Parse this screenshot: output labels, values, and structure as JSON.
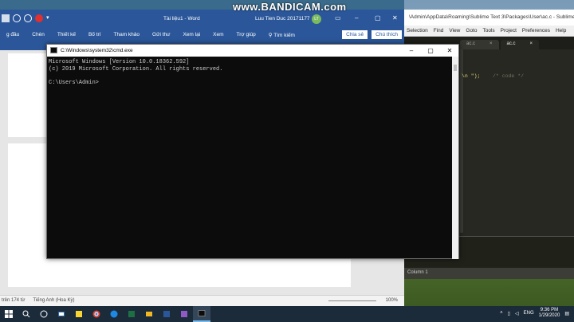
{
  "watermark": "www.BANDICAM.com",
  "sublime": {
    "title": "\\Admin\\AppData\\Roaming\\Sublime Text 3\\Packages\\User\\ac.c - Sublime",
    "menu": [
      "Selection",
      "Find",
      "View",
      "Goto",
      "Tools",
      "Project",
      "Preferences",
      "Help"
    ],
    "tabs": [
      {
        "label": "ac.c",
        "active": false
      },
      {
        "label": "ac.c",
        "active": true
      }
    ],
    "code_string": "\\n \");",
    "code_comment": "/* code */",
    "status": "Column 1"
  },
  "word": {
    "doc_title": "Tài liệu1 - Word",
    "user": "Luu Tien Duc 20171177",
    "user_initials": "LT",
    "ribbon_tabs": [
      "g đầu",
      "Chèn",
      "Thiết kế",
      "Bố trí",
      "Tham khảo",
      "Gửi thư",
      "Xem lại",
      "Xem",
      "Trợ giúp",
      "Tìm kiếm"
    ],
    "share_label": "Chia sẻ",
    "comment_label": "Chú thích",
    "status_words": "trên 174 từ",
    "status_lang": "Tiếng Anh (Hoa Kỳ)",
    "zoom": "100%"
  },
  "cmd": {
    "title": "C:\\Windows\\system32\\cmd.exe",
    "lines": [
      "Microsoft Windows [Version 10.0.18362.592]",
      "(c) 2019 Microsoft Corporation. All rights reserved.",
      "",
      "C:\\Users\\Admin>"
    ]
  },
  "taskbar": {
    "apps": [
      "search-icon",
      "task-view-icon",
      "explorer-icon",
      "sticky-notes-icon",
      "chrome-icon",
      "edge-icon",
      "excel-icon",
      "file-manager-icon",
      "word-icon",
      "visual-studio-icon",
      "cmd-icon"
    ],
    "active_app": "cmd-icon",
    "language": "ENG",
    "time": "9:36 PM",
    "date": "1/29/2020"
  }
}
